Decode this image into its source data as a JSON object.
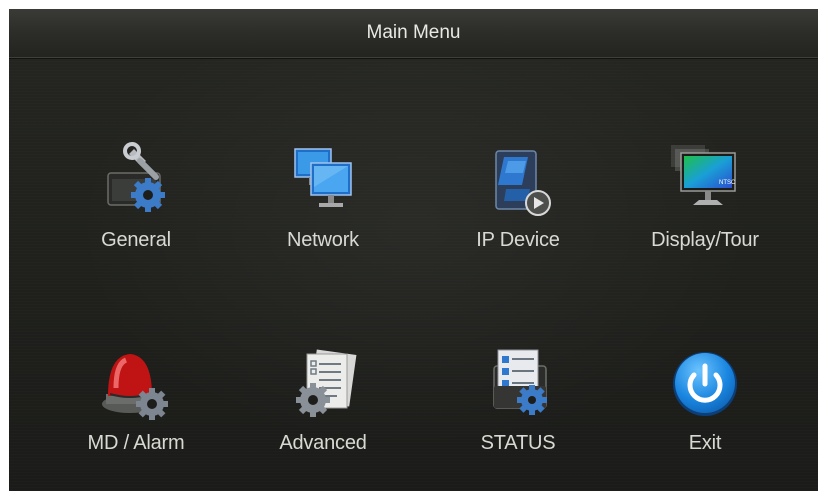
{
  "window": {
    "title": "Main Menu"
  },
  "menu": {
    "items": [
      {
        "label": "General",
        "icon": "general-settings-icon"
      },
      {
        "label": "Network",
        "icon": "network-monitors-icon"
      },
      {
        "label": "IP Device",
        "icon": "ip-device-icon"
      },
      {
        "label": "Display/Tour",
        "icon": "display-monitor-icon",
        "badge": "NTSC"
      },
      {
        "label": "MD / Alarm",
        "icon": "alarm-siren-icon"
      },
      {
        "label": "Advanced",
        "icon": "advanced-document-gear-icon"
      },
      {
        "label": "STATUS",
        "icon": "status-checklist-icon"
      },
      {
        "label": "Exit",
        "icon": "power-icon"
      }
    ]
  },
  "colors": {
    "background": "#20211d",
    "title_bar": "#2d2e2a",
    "text": "#d9d9d4",
    "accent_blue": "#1e88e5",
    "alarm_red": "#d01818"
  }
}
